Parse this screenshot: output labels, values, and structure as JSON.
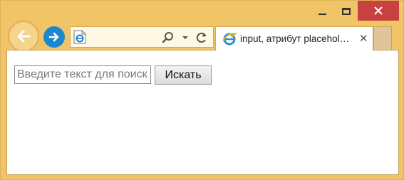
{
  "titlebar": {
    "minimize_icon": "minimize-icon",
    "maximize_icon": "maximize-icon",
    "close_icon": "close-icon",
    "close_color": "#c6413f"
  },
  "nav": {
    "back_icon": "back-arrow-icon",
    "forward_icon": "forward-arrow-icon",
    "forward_color": "#1a88d0"
  },
  "address_bar": {
    "value": "",
    "favicon": "ie-page-icon",
    "search_icon": "search-icon",
    "dropdown_icon": "chevron-down-icon",
    "refresh_icon": "refresh-icon"
  },
  "tab": {
    "title": "input, атрибут placehol…",
    "favicon": "ie-logo-icon",
    "close_label": "✕"
  },
  "page": {
    "search_placeholder": "Введите текст для поиска",
    "search_value": "",
    "button_label": "Искать"
  },
  "colors": {
    "frame": "#f1c567"
  }
}
